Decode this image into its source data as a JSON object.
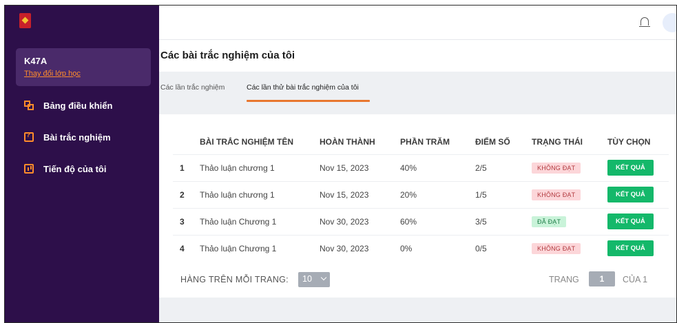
{
  "sidebar": {
    "class_name": "K47A",
    "change_class": "Thay đổi lớp học",
    "items": [
      {
        "label": "Bảng điều khiển",
        "icon": "dashboard-icon"
      },
      {
        "label": "Bài trắc nghiệm",
        "icon": "quiz-icon"
      },
      {
        "label": "Tiến độ của tôi",
        "icon": "progress-chart-icon"
      }
    ]
  },
  "header": {
    "page_title": "Các bài trắc nghiệm của tôi"
  },
  "tabs": [
    {
      "label": "Các lần trắc nghiệm",
      "active": false
    },
    {
      "label": "Các lần thử bài trắc nghiệm của tôi",
      "active": true
    }
  ],
  "table": {
    "columns": [
      "",
      "BÀI TRẮC NGHIỆM TÊN",
      "HOÀN THÀNH",
      "PHẦN TRĂM",
      "ĐIỂM SỐ",
      "TRẠNG THÁI",
      "TÙY CHỌN"
    ],
    "rows": [
      {
        "idx": "1",
        "name": "Thảo luận chương 1",
        "date": "Nov 15, 2023",
        "pct": "40%",
        "score": "2/5",
        "status": "KHÔNG ĐẠT",
        "passed": false,
        "action": "KẾT QUẢ"
      },
      {
        "idx": "2",
        "name": "Thảo luận chương 1",
        "date": "Nov 15, 2023",
        "pct": "20%",
        "score": "1/5",
        "status": "KHÔNG ĐẠT",
        "passed": false,
        "action": "KẾT QUẢ"
      },
      {
        "idx": "3",
        "name": "Thảo luận Chương 1",
        "date": "Nov 30, 2023",
        "pct": "60%",
        "score": "3/5",
        "status": "ĐÃ ĐẠT",
        "passed": true,
        "action": "KẾT QUẢ"
      },
      {
        "idx": "4",
        "name": "Thảo luận Chương 1",
        "date": "Nov 30, 2023",
        "pct": "0%",
        "score": "0/5",
        "status": "KHÔNG ĐẠT",
        "passed": false,
        "action": "KẾT QUẢ"
      }
    ]
  },
  "pagination": {
    "rows_label": "HÀNG TRÊN MỖI TRANG:",
    "rows_value": "10",
    "page_label": "TRANG",
    "page_value": "1",
    "of_label": "CỦA 1"
  },
  "colors": {
    "sidebar_bg": "#2d0f4a",
    "accent": "#e8772e",
    "success": "#14b86a",
    "fail_badge": "#fcd6d9",
    "pass_badge": "#c9f3d9"
  }
}
